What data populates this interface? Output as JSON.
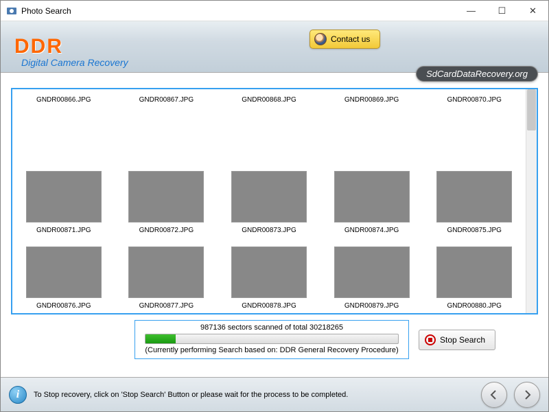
{
  "window": {
    "title": "Photo Search"
  },
  "header": {
    "logo": "DDR",
    "subtitle": "Digital Camera Recovery",
    "contact_label": "Contact us",
    "site_badge": "SdCardDataRecovery.org"
  },
  "grid": {
    "row_labels_top": [
      "GNDR00866.JPG",
      "GNDR00867.JPG",
      "GNDR00868.JPG",
      "GNDR00869.JPG",
      "GNDR00870.JPG"
    ],
    "items": [
      {
        "name": "GNDR00871.JPG",
        "cls": "ph1"
      },
      {
        "name": "GNDR00872.JPG",
        "cls": "ph2"
      },
      {
        "name": "GNDR00873.JPG",
        "cls": "ph3"
      },
      {
        "name": "GNDR00874.JPG",
        "cls": "ph4"
      },
      {
        "name": "GNDR00875.JPG",
        "cls": "ph5"
      },
      {
        "name": "GNDR00876.JPG",
        "cls": "ph6"
      },
      {
        "name": "GNDR00877.JPG",
        "cls": "ph7"
      },
      {
        "name": "GNDR00878.JPG",
        "cls": "ph8"
      },
      {
        "name": "GNDR00879.JPG",
        "cls": "ph9"
      },
      {
        "name": "GNDR00880.JPG",
        "cls": "ph10"
      }
    ]
  },
  "progress": {
    "sectors_text": "987136 sectors scanned of total 30218265",
    "method_text": "(Currently performing Search based on:  DDR General Recovery Procedure)",
    "percent": 12,
    "stop_label": "Stop Search"
  },
  "footer": {
    "hint": "To Stop recovery, click on 'Stop Search' Button or please wait for the process to be completed."
  }
}
